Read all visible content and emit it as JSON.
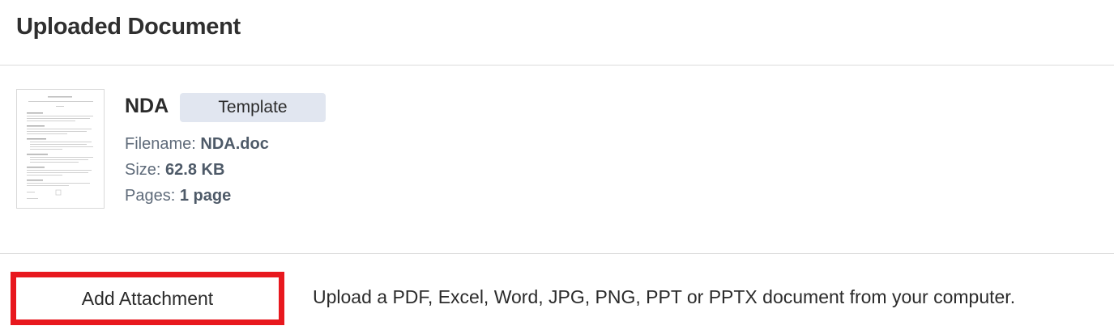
{
  "header": {
    "title": "Uploaded Document"
  },
  "document": {
    "title": "NDA",
    "badge": "Template",
    "filename": {
      "label": "Filename:",
      "value": "NDA.doc"
    },
    "size": {
      "label": "Size:",
      "value": "62.8 KB"
    },
    "pages": {
      "label": "Pages:",
      "value": "1 page"
    },
    "thumbnail_icon": "document-page-thumbnail"
  },
  "attachment": {
    "button_label": "Add Attachment",
    "hint": "Upload a PDF, Excel, Word, JPG, PNG, PPT or PPTX document from your computer.",
    "highlight_color": "#e8181e"
  },
  "colors": {
    "badge_bg": "#e1e6f0",
    "meta_text": "#5f6b7a",
    "divider": "#dcdcdc"
  }
}
